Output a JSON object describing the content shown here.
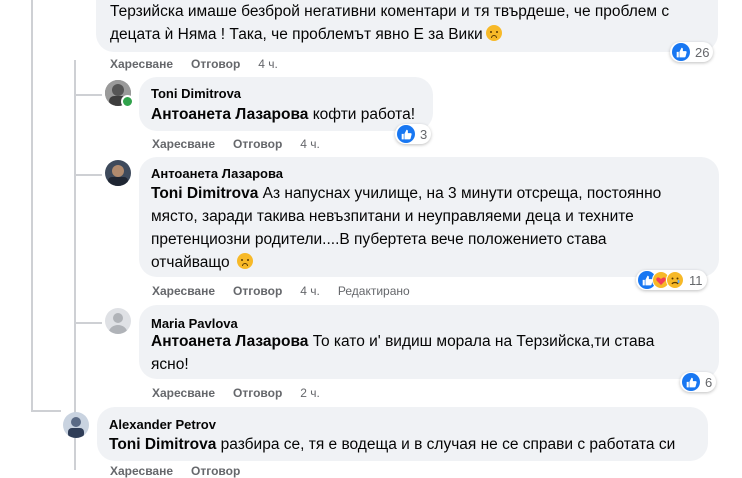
{
  "colors": {
    "like_blue": "#1877f2",
    "bubble_bg": "#f0f2f5",
    "meta_gray": "#65676b",
    "online_green": "#31a24c"
  },
  "actions": {
    "like": "Харесване",
    "reply": "Отговор"
  },
  "comment_top": {
    "line1": "Терзийска имаше безброй негативни коментари и тя твърдеше, че проблем с",
    "line2": "децата ѝ Няма ! Така, че проблемът явно Е за Вики",
    "time": "4 ч.",
    "reactions": "26"
  },
  "reply1": {
    "author": "Toni Dimitrova",
    "mention": "Антоанета Лазарова",
    "text": " кофти работа!",
    "time": "4 ч.",
    "reactions": "3"
  },
  "reply2": {
    "author": "Антоанета Лазарова",
    "mention": "Toni Dimitrova",
    "line1": " Аз напуснах училище, на 3 минути отсреща, постоянно",
    "line2": "място, заради такива невъзпитани и неуправляеми деца и техните",
    "line3": "претенциозни родители....В пубертета вече положението става",
    "line4": "отчайващо",
    "time": "4 ч.",
    "edited": "Редактирано",
    "reactions": "11"
  },
  "reply3": {
    "author": "Maria Pavlova",
    "mention": "Антоанета Лазарова",
    "line1": " То като и' видиш морала на Терзийска,ти става",
    "line2": "ясно!",
    "time": "2 ч.",
    "reactions": "6"
  },
  "comment_bottom": {
    "author": "Alexander Petrov",
    "mention": "Toni Dimitrova",
    "text": " разбира се, тя е водеща и в случая не се справи с работата си",
    "like": "Харесване",
    "reply": "Отговор"
  }
}
